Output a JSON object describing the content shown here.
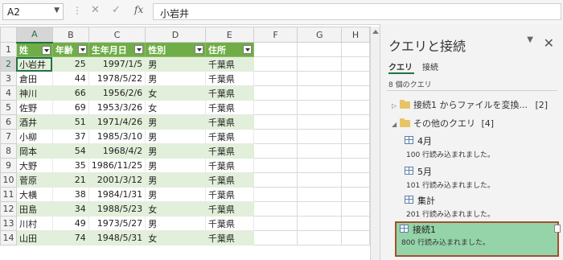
{
  "formula_bar": {
    "name_box": "A2",
    "cancel_icon": "✕",
    "enter_icon": "✓",
    "fx_label": "fx",
    "content": "小岩井"
  },
  "sheet": {
    "columns": [
      "A",
      "B",
      "C",
      "D",
      "E",
      "F",
      "G",
      "H"
    ],
    "rows": [
      "1",
      "2",
      "3",
      "4",
      "5",
      "6",
      "7",
      "8",
      "9",
      "10",
      "11",
      "12",
      "13",
      "14"
    ],
    "headers": [
      "姓",
      "年齢",
      "生年月日",
      "性別",
      "住所"
    ],
    "data": [
      [
        "小岩井",
        "25",
        "1997/1/5",
        "男",
        "千葉県"
      ],
      [
        "倉田",
        "44",
        "1978/5/22",
        "男",
        "千葉県"
      ],
      [
        "神川",
        "66",
        "1956/2/6",
        "女",
        "千葉県"
      ],
      [
        "佐野",
        "69",
        "1953/3/26",
        "女",
        "千葉県"
      ],
      [
        "酒井",
        "51",
        "1971/4/26",
        "男",
        "千葉県"
      ],
      [
        "小柳",
        "37",
        "1985/3/10",
        "男",
        "千葉県"
      ],
      [
        "岡本",
        "54",
        "1968/4/2",
        "男",
        "千葉県"
      ],
      [
        "大野",
        "35",
        "1986/11/25",
        "男",
        "千葉県"
      ],
      [
        "菅原",
        "21",
        "2001/3/12",
        "男",
        "千葉県"
      ],
      [
        "大横",
        "38",
        "1984/1/31",
        "男",
        "千葉県"
      ],
      [
        "田島",
        "34",
        "1988/5/23",
        "女",
        "千葉県"
      ],
      [
        "川村",
        "49",
        "1973/5/27",
        "男",
        "千葉県"
      ],
      [
        "山田",
        "74",
        "1948/5/31",
        "女",
        "千葉県"
      ]
    ]
  },
  "query_pane": {
    "title": "クエリと接続",
    "tabs": [
      "クエリ",
      "接続"
    ],
    "count": "8 個のクエリ",
    "group1": "接続1 からファイルを変換...",
    "group1_count": "[2]",
    "group2": "その他のクエリ",
    "group2_count": "[4]",
    "queries": [
      {
        "name": "4月",
        "status": "100 行読み込まれました。"
      },
      {
        "name": "5月",
        "status": "101 行読み込まれました。"
      },
      {
        "name": "集計",
        "status": "201 行読み込まれました。"
      },
      {
        "name": "接続1",
        "status": "800 行読み込まれました。"
      }
    ],
    "colors": {
      "selected_bg": "#95d4a9",
      "selected_border": "#a0522d",
      "accent": "#217346"
    }
  }
}
